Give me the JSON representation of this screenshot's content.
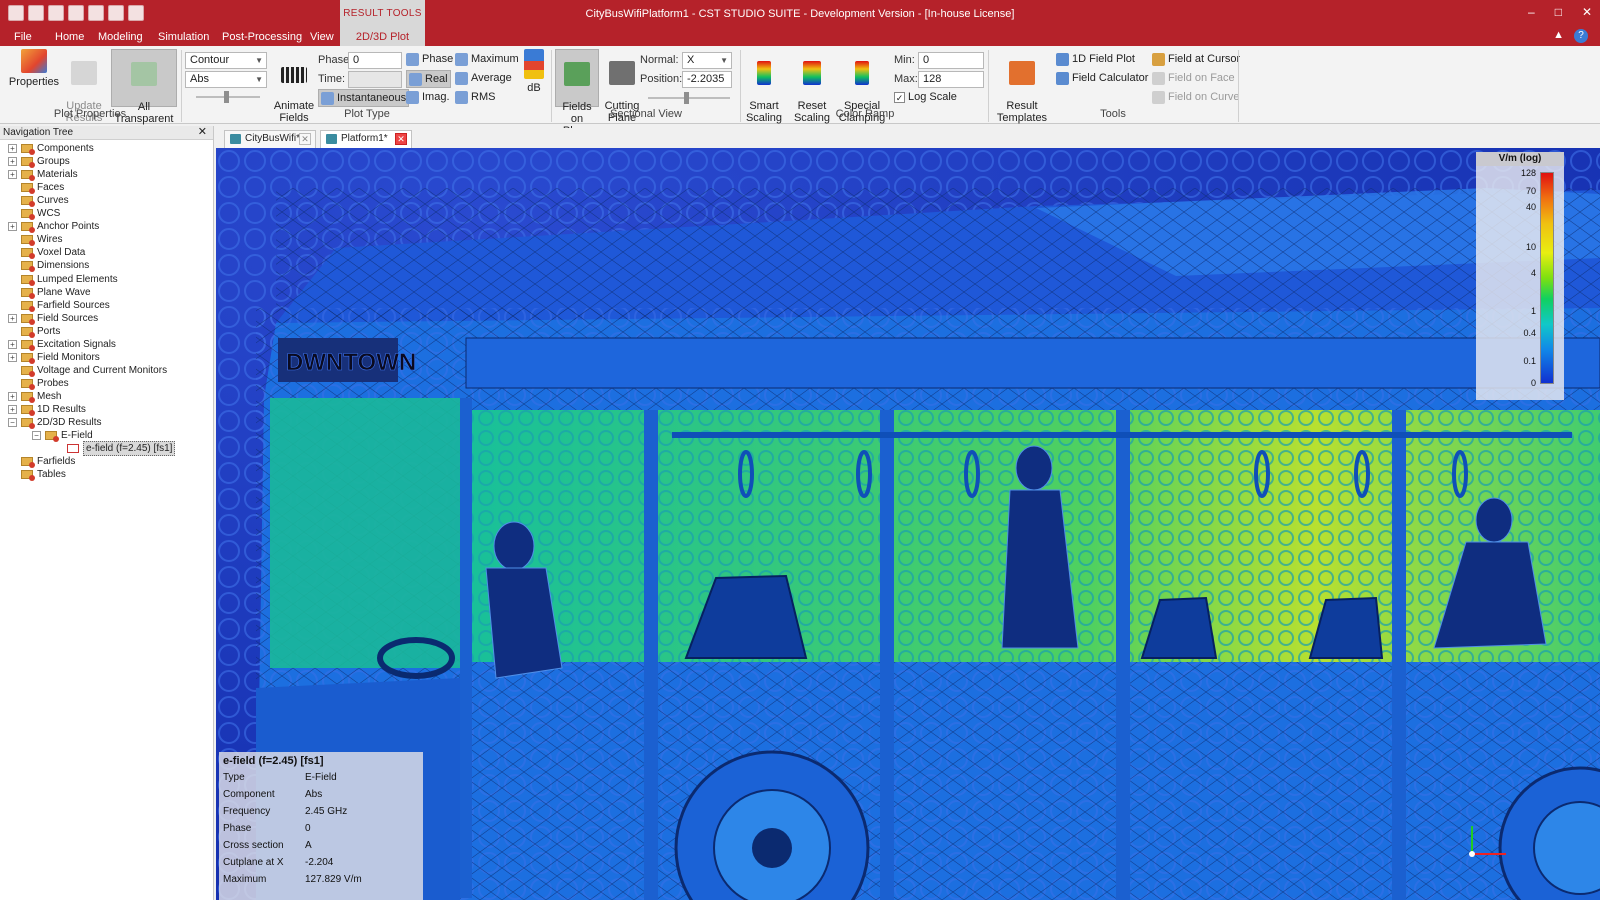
{
  "window": {
    "title": "CityBusWifiPlatform1 - CST STUDIO SUITE - Development Version - [In-house License]",
    "context_tab_label": "RESULT TOOLS",
    "controls": [
      "–",
      "□",
      "✕"
    ]
  },
  "ribbon_tabs": {
    "items": [
      "File",
      "Home",
      "Modeling",
      "Simulation",
      "Post-Processing",
      "View"
    ],
    "active_context": "2D/3D Plot"
  },
  "ribbon": {
    "plot_properties": {
      "label": "Plot Properties",
      "properties": "Properties",
      "update_results": "Update\nResults",
      "all_transparent": "All\nTransparent"
    },
    "plot_type": {
      "label": "Plot Type",
      "style_select": "Contour",
      "component_select": "Abs",
      "animate_fields": "Animate\nFields",
      "phase_label": "Phase:",
      "phase_value": "0",
      "time_label": "Time:",
      "time_value": "",
      "instantaneous": "Instantaneous",
      "phase": "Phase",
      "real": "Real",
      "imag": "Imag.",
      "maximum": "Maximum",
      "average": "Average",
      "rms": "RMS",
      "db": "dB"
    },
    "sectional_view": {
      "label": "Sectional View",
      "fields_on_plane": "Fields on\nPlane",
      "cutting_plane": "Cutting\nPlane",
      "normal_label": "Normal:",
      "normal_value": "X",
      "position_label": "Position:",
      "position_value": "-2.2035"
    },
    "color_ramp": {
      "label": "Color Ramp",
      "smart_scaling": "Smart\nScaling",
      "reset_scaling": "Reset\nScaling",
      "special_clamping": "Special\nClamping",
      "min_label": "Min:",
      "min_value": "0",
      "max_label": "Max:",
      "max_value": "128",
      "log_scale": "Log Scale",
      "log_scale_checked": true
    },
    "tools": {
      "label": "Tools",
      "result_templates": "Result\nTemplates",
      "field_plot_1d": "1D Field Plot",
      "field_calculator": "Field Calculator",
      "field_at_cursor": "Field at Cursor",
      "field_on_face": "Field on Face",
      "field_on_curve": "Field on Curve"
    }
  },
  "nav_tree": {
    "title": "Navigation Tree",
    "items": [
      {
        "label": "Components",
        "expand": "+"
      },
      {
        "label": "Groups",
        "expand": "+"
      },
      {
        "label": "Materials",
        "expand": "+"
      },
      {
        "label": "Faces",
        "expand": ""
      },
      {
        "label": "Curves",
        "expand": ""
      },
      {
        "label": "WCS",
        "expand": ""
      },
      {
        "label": "Anchor Points",
        "expand": "+"
      },
      {
        "label": "Wires",
        "expand": ""
      },
      {
        "label": "Voxel Data",
        "expand": ""
      },
      {
        "label": "Dimensions",
        "expand": ""
      },
      {
        "label": "Lumped Elements",
        "expand": ""
      },
      {
        "label": "Plane Wave",
        "expand": ""
      },
      {
        "label": "Farfield Sources",
        "expand": ""
      },
      {
        "label": "Field Sources",
        "expand": "+"
      },
      {
        "label": "Ports",
        "expand": ""
      },
      {
        "label": "Excitation Signals",
        "expand": "+"
      },
      {
        "label": "Field Monitors",
        "expand": "+"
      },
      {
        "label": "Voltage and Current Monitors",
        "expand": ""
      },
      {
        "label": "Probes",
        "expand": ""
      },
      {
        "label": "Mesh",
        "expand": "+"
      },
      {
        "label": "1D Results",
        "expand": "+"
      },
      {
        "label": "2D/3D Results",
        "expand": "−"
      },
      {
        "label": "E-Field",
        "expand": "−"
      },
      {
        "label": "e-field (f=2.45) [fs1]",
        "expand": ""
      },
      {
        "label": "Farfields",
        "expand": ""
      },
      {
        "label": "Tables",
        "expand": ""
      }
    ]
  },
  "doc_tabs": [
    {
      "label": "CityBusWifi*"
    },
    {
      "label": "Platform1*"
    }
  ],
  "legend": {
    "title": "V/m (log)",
    "ticks": [
      "128",
      "70",
      "40",
      "10",
      "4",
      "1",
      "0.4",
      "0.1",
      "0"
    ],
    "colors": [
      "#e01010",
      "#f07010",
      "#e8ee10",
      "#7ee010",
      "#10c8c8",
      "#1030d0"
    ]
  },
  "info": {
    "title": "e-field (f=2.45) [fs1]",
    "rows": [
      {
        "k": "Type",
        "v": "E-Field"
      },
      {
        "k": "Component",
        "v": "Abs"
      },
      {
        "k": "Frequency",
        "v": "2.45 GHz"
      },
      {
        "k": "Phase",
        "v": "0"
      },
      {
        "k": "Cross section",
        "v": "A"
      },
      {
        "k": "Cutplane at X",
        "v": "-2.204"
      },
      {
        "k": "Maximum",
        "v": "127.829 V/m"
      }
    ]
  },
  "scene": {
    "destination_sign": "DWNTOWN",
    "colors": {
      "background": "#1733b8",
      "body": "#1c6fe0",
      "interior": "#22c08a",
      "hot": "#b8e030"
    }
  }
}
